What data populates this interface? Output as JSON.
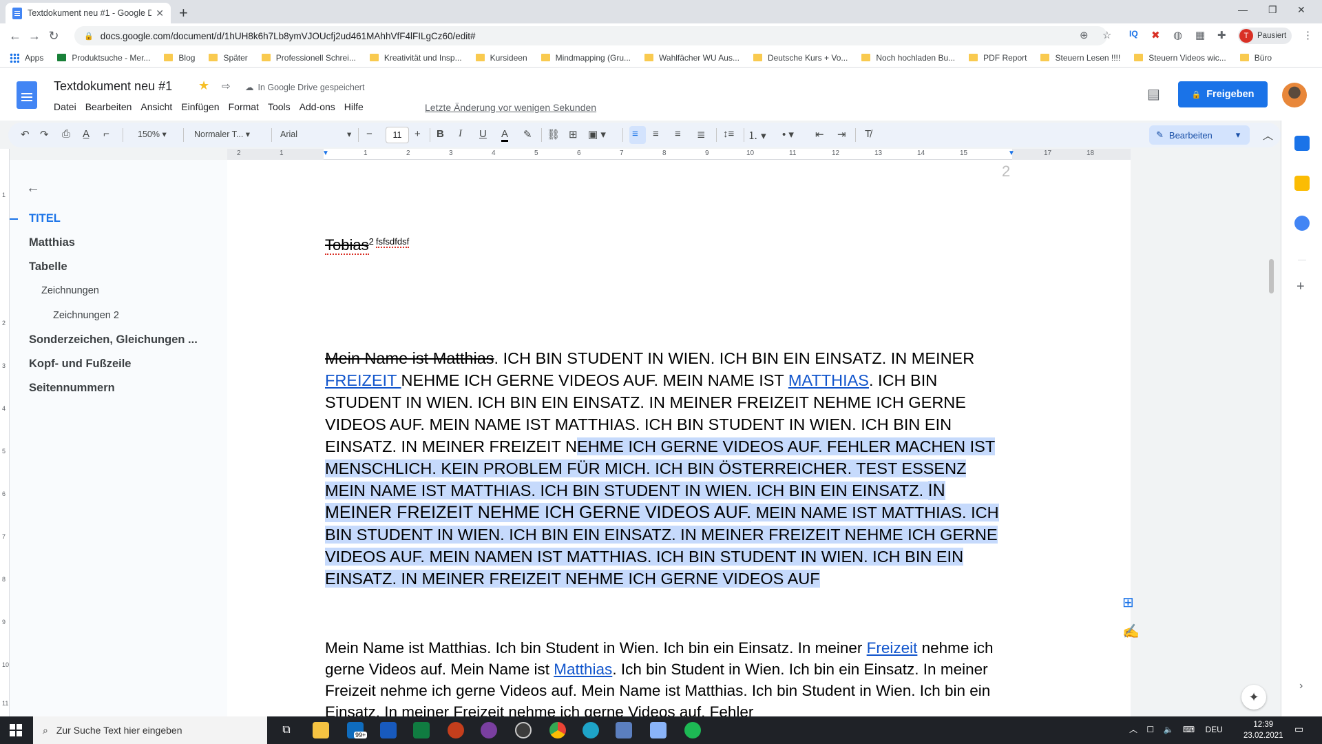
{
  "browser": {
    "tab_title": "Textdokument neu #1 - Google Docs",
    "url": "docs.google.com/document/d/1hUH8k6h7Lb8ymVJOUcfj2ud461MAhhVfF4lFILgCz60/edit#",
    "profile_label": "Pausiert",
    "profile_initial": "T",
    "bookmarks": [
      "Apps",
      "Produktsuche - Mer...",
      "Blog",
      "Später",
      "Professionell Schrei...",
      "Kreativität und Insp...",
      "Kursideen",
      "Mindmapping  (Gru...",
      "Wahlfächer WU Aus...",
      "Deutsche Kurs + Vo...",
      "Noch hochladen Bu...",
      "PDF Report",
      "Steuern Lesen !!!!",
      "Steuern Videos wic...",
      "Büro"
    ]
  },
  "docs": {
    "title": "Textdokument neu #1",
    "saved_status": "In Google Drive gespeichert",
    "menu": [
      "Datei",
      "Bearbeiten",
      "Ansicht",
      "Einfügen",
      "Format",
      "Tools",
      "Add-ons",
      "Hilfe"
    ],
    "last_edit": "Letzte Änderung vor wenigen Sekunden",
    "share_label": "Freigeben"
  },
  "toolbar": {
    "zoom": "150%",
    "style": "Normaler T...",
    "font": "Arial",
    "font_size": "11",
    "mode": "Bearbeiten"
  },
  "ruler_numbers": [
    "2",
    "1",
    "1",
    "2",
    "3",
    "4",
    "5",
    "6",
    "7",
    "8",
    "9",
    "10",
    "11",
    "12",
    "13",
    "14",
    "15",
    "16",
    "17",
    "18"
  ],
  "left_ruler_numbers": [
    "1",
    "2",
    "3",
    "4",
    "5",
    "6",
    "7",
    "8",
    "9",
    "10",
    "11"
  ],
  "outline": {
    "items": [
      {
        "label": "TITEL"
      },
      {
        "label": "Matthias"
      },
      {
        "label": "Tabelle"
      },
      {
        "label": "Zeichnungen"
      },
      {
        "label": "Zeichnungen 2"
      },
      {
        "label": "Sonderzeichen, Gleichungen ..."
      },
      {
        "label": "Kopf- und Fußzeile"
      },
      {
        "label": "Seitennummern"
      }
    ]
  },
  "document": {
    "page_number": "2",
    "header_name": "Tobias",
    "header_sup": "2",
    "header_small": "fsfsdfdsf",
    "p1": {
      "strike": "Mein Name ist Matthias",
      "t1": ". ICH BIN STUDENT IN WIEN. ICH BIN EIN EINSATZ. IN MEINER ",
      "link1": "FREIZEIT ",
      "t2": "NEHME ICH GERNE VIDEOS AUF. MEIN NAME IST ",
      "link2": "MATTHIAS",
      "t3": ". ICH BIN STUDENT IN WIEN. ICH BIN EIN EINSATZ. IN MEINER FREIZEIT NEHME ICH GERNE VIDEOS AUF. MEIN NAME IST MATTHIAS. ICH BIN STUDENT IN WIEN. ICH BIN EIN EINSATZ. IN MEINER FREIZEIT N",
      "sel1": "EHME ICH GERNE VIDEOS AUF. FEHLER MACHEN IST MENSCHLICH. KEIN PROBLEM FÜR MICH. ICH BIN ÖSTERREICHER. TEST ESSENZ ",
      "sel2": "MEIN NAME IST MATTHIAS. ICH BIN STUDENT IN WIEN. ICH BIN EIN EINSATZ. ",
      "sel3": "IN MEINER FREIZEIT NEHME ICH GERNE VIDEOS AUF.",
      "sel4": " MEIN NAME IST MATTHIAS. ICH BIN STUDENT IN WIEN. ICH BIN EIN EINSATZ. IN MEINER FREIZEIT NEHME ICH GERNE VIDEOS AUF. MEIN NAMEN IST MATTHIAS. ICH BIN STUDENT IN WIEN. ICH BIN EIN EINSATZ. IN MEINER FREIZEIT NEHME ICH GERNE VIDEOS AUF"
    },
    "p2": {
      "t1": "Mein Name ist Matthias. Ich bin Student in Wien. Ich bin ein Einsatz. In meiner ",
      "link1": "Freizeit",
      "t2": " nehme ich gerne Videos auf. Mein Name ist ",
      "link2": "Matthias",
      "t3": ". Ich bin Student in Wien. Ich bin ein Einsatz. In meiner Freizeit nehme ich gerne Videos auf. Mein Name ist Matthias. Ich bin Student in Wien. Ich bin ein Einsatz. In meiner Freizeit nehme ich gerne Videos auf. Fehler"
    }
  },
  "taskbar": {
    "search_placeholder": "Zur Suche Text hier eingeben",
    "mail_badge": "99+",
    "language": "DEU",
    "time": "12:39",
    "date": "23.02.2021"
  }
}
